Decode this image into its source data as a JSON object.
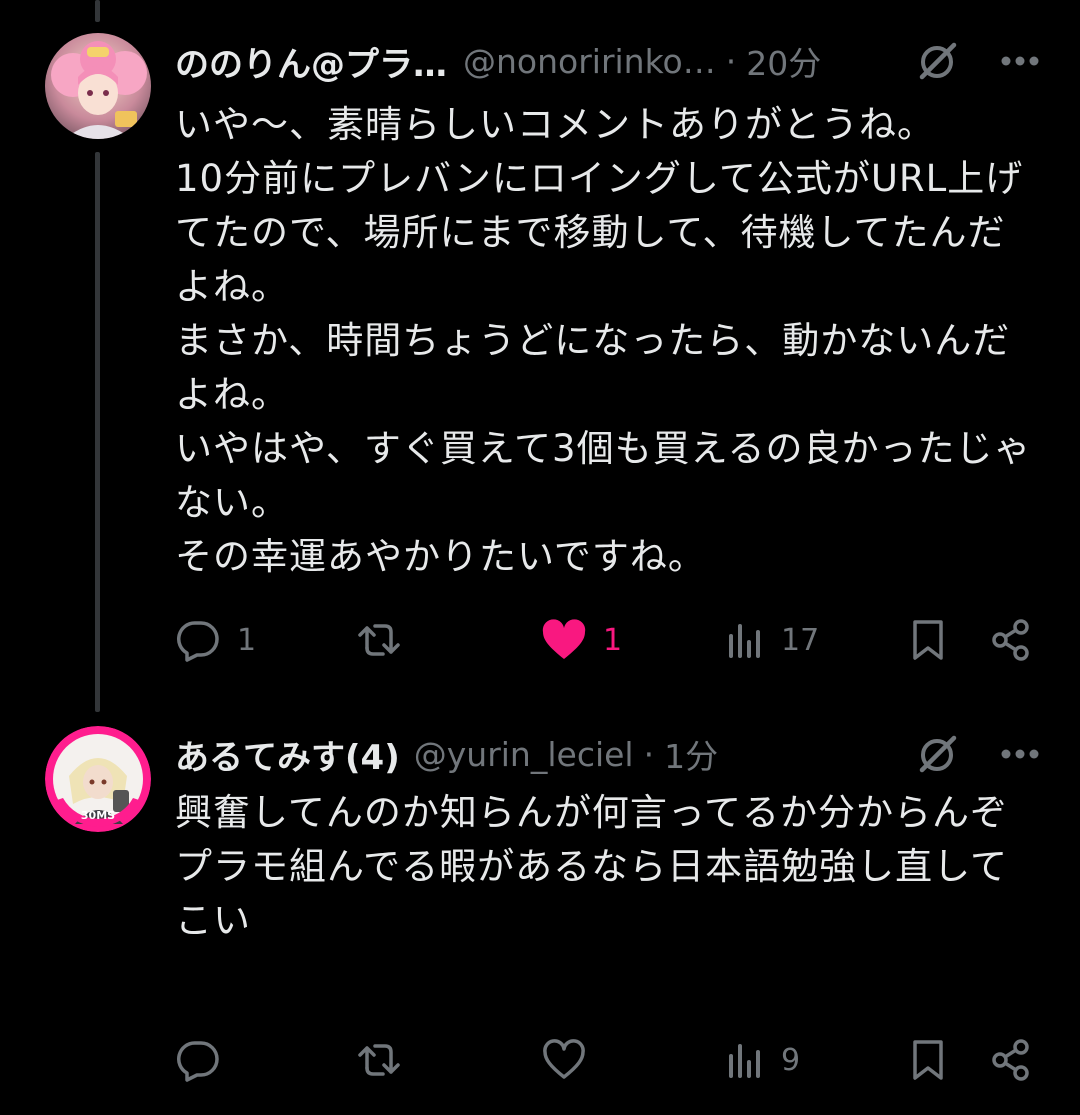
{
  "tweets": [
    {
      "display_name": "ののりん@プラ…",
      "handle": "@nonoririnko…",
      "separator": "·",
      "time": "20分",
      "text": "いや〜、素晴らしいコメントありがとうね。\n10分前にプレバンにロイングして公式がURL上げてたので、場所にまで移動して、待機してたんだよね。\nまさか、時間ちょうどになったら、動かないんだよね。\nいやはや、すぐ買えて3個も買えるの良かったじゃない。\nその幸運あやかりたいですね。",
      "replies": "1",
      "retweets": "",
      "likes": "1",
      "views": "17",
      "liked": true
    },
    {
      "display_name": "あるてみす(4)",
      "handle": "@yurin_leciel",
      "separator": "·",
      "time": "1分",
      "text": "興奮してんのか知らんが何言ってるか分からんぞ\nプラモ組んでる暇があるなら日本語勉強し直してこい",
      "replies": "",
      "retweets": "",
      "likes": "",
      "views": "9",
      "liked": false,
      "avatar_badge": "30MS"
    }
  ],
  "colors": {
    "background": "#000000",
    "text": "#e7e9ea",
    "secondary": "#71767b",
    "like": "#f91880",
    "thread_line": "#333639",
    "avatar_ring": "#ff1d8e"
  }
}
